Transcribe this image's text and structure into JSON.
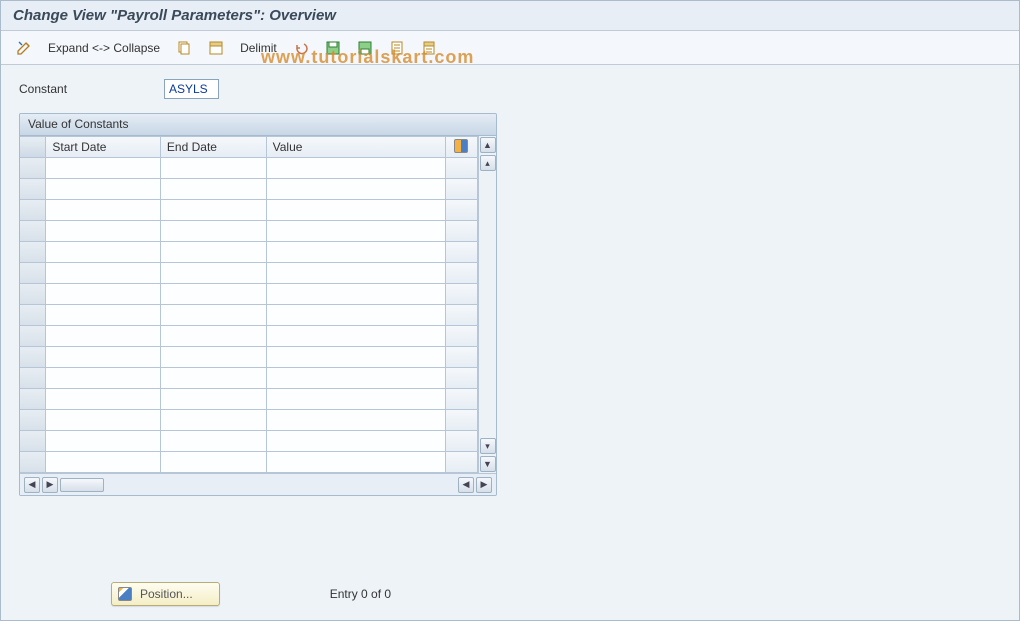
{
  "header": {
    "title": "Change View \"Payroll Parameters\": Overview"
  },
  "toolbar": {
    "expand_collapse_label": "Expand <-> Collapse",
    "delimit_label": "Delimit",
    "icons": {
      "toggle": "toggle-icon",
      "copy": "copy-icon",
      "select_all": "select-all-icon",
      "undo": "undo-icon",
      "save1": "save-icon",
      "save2": "save-variant-icon",
      "form1": "form-icon",
      "form2": "form2-icon"
    }
  },
  "watermark": "www.tutorialskart.com",
  "field": {
    "label": "Constant",
    "value": "ASYLS"
  },
  "panel": {
    "title": "Value of Constants",
    "columns": {
      "start_date": "Start Date",
      "end_date": "End Date",
      "value": "Value"
    },
    "row_count": 15
  },
  "footer": {
    "position_label": "Position...",
    "entry_text": "Entry 0 of 0"
  }
}
